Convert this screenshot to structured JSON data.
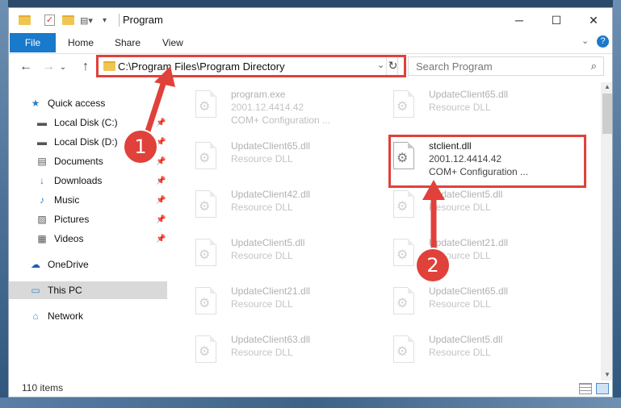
{
  "window": {
    "title": "Program"
  },
  "ribbon": {
    "file": "File",
    "home": "Home",
    "share": "Share",
    "view": "View"
  },
  "address": {
    "path": "C:\\Program Files\\Program Directory"
  },
  "search": {
    "placeholder": "Search Program"
  },
  "sidebar": {
    "items": [
      {
        "label": "Quick access",
        "icon": "star-icon"
      },
      {
        "label": "Local Disk (C:)",
        "icon": "drive-icon",
        "pinned": true
      },
      {
        "label": "Local Disk (D:)",
        "icon": "drive-icon",
        "pinned": true
      },
      {
        "label": "Documents",
        "icon": "documents-icon",
        "pinned": true
      },
      {
        "label": "Downloads",
        "icon": "downloads-icon",
        "pinned": true
      },
      {
        "label": "Music",
        "icon": "music-icon",
        "pinned": true
      },
      {
        "label": "Pictures",
        "icon": "pictures-icon",
        "pinned": true
      },
      {
        "label": "Videos",
        "icon": "videos-icon",
        "pinned": true
      },
      {
        "label": "OneDrive",
        "icon": "cloud-icon"
      },
      {
        "label": "This PC",
        "icon": "computer-icon",
        "selected": true
      },
      {
        "label": "Network",
        "icon": "network-icon"
      }
    ]
  },
  "files": [
    {
      "name": "program.exe",
      "line2": "2001.12.4414.42",
      "line3": "COM+ Configuration ...",
      "faded": true
    },
    {
      "name": "UpdateClient65.dll",
      "line2": "Resource DLL",
      "faded": true
    },
    {
      "name": "UpdateClient65.dll",
      "line2": "Resource DLL",
      "faded": true
    },
    {
      "name": "stclient.dll",
      "line2": "2001.12.4414.42",
      "line3": "COM+ Configuration ...",
      "faded": false
    },
    {
      "name": "UpdateClient42.dll",
      "line2": "Resource DLL",
      "faded": true
    },
    {
      "name": "UpdateClient5.dll",
      "line2": "Resource DLL",
      "faded": true
    },
    {
      "name": "UpdateClient5.dll",
      "line2": "Resource DLL",
      "faded": true
    },
    {
      "name": "UpdateClient21.dll",
      "line2": "Resource DLL",
      "faded": true
    },
    {
      "name": "UpdateClient21.dll",
      "line2": "Resource DLL",
      "faded": true
    },
    {
      "name": "UpdateClient65.dll",
      "line2": "Resource DLL",
      "faded": true
    },
    {
      "name": "UpdateClient63.dll",
      "line2": "Resource DLL",
      "faded": true
    },
    {
      "name": "UpdateClient5.dll",
      "line2": "Resource DLL",
      "faded": true
    }
  ],
  "status": {
    "count": "110 items"
  },
  "callouts": {
    "one": "1",
    "two": "2"
  },
  "colors": {
    "accent": "#1979ca",
    "highlight": "#e0413a"
  }
}
